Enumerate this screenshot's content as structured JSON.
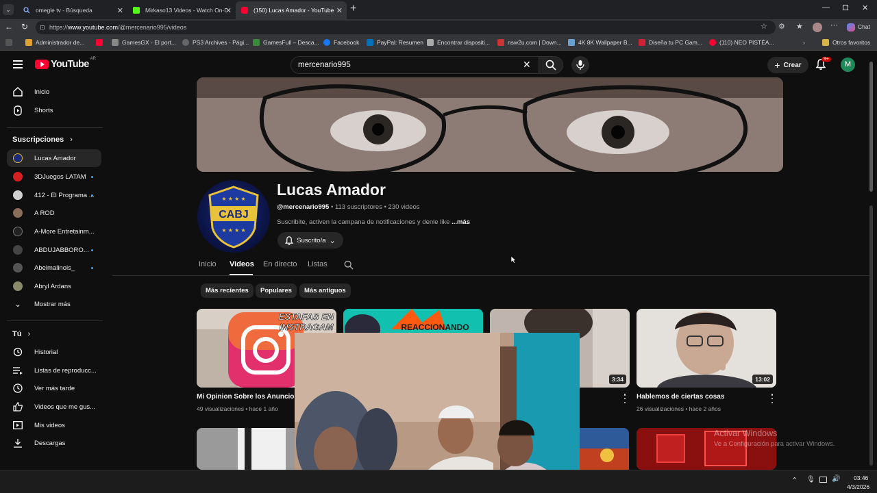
{
  "browser": {
    "tabs": [
      {
        "label": "omegle tv - Búsqueda",
        "active": false
      },
      {
        "label": "Mirkaso13 Videos - Watch On-De",
        "active": false
      },
      {
        "label": "(150) Lucas Amador - YouTube",
        "active": true
      }
    ],
    "new_tab": "+",
    "url_prefix": "https://",
    "url_domain": "www.youtube.com",
    "url_path": "/@mercenario995/videos",
    "chat_label": "Chat",
    "bookmarks": [
      "Administrador de...",
      "GamesGX - El port...",
      "PS3 Archives - Pági...",
      "GamesFull – Desca...",
      "Facebook",
      "PayPal: Resumen",
      "Encontrar dispositi...",
      "nsw2u.com | Down...",
      "4K 8K Wallpaper B...",
      "Diseña tu PC Gam...",
      "(110) NEO PISTÉA..."
    ],
    "other_favorites": "Otros favoritos"
  },
  "youtube": {
    "logo_text": "YouTube",
    "region": "AR",
    "search_value": "mercenario995",
    "create_label": "Crear",
    "notif_badge": "9+",
    "account_initial": "M"
  },
  "sidebar": {
    "top": [
      {
        "label": "Inicio",
        "icon": "home-icon"
      },
      {
        "label": "Shorts",
        "icon": "shorts-icon"
      }
    ],
    "subs_heading": "Suscripciones",
    "subs": [
      {
        "label": "Lucas Amador",
        "color": "#1d2a7a",
        "dot": false
      },
      {
        "label": "3DJuegos LATAM",
        "color": "#d42020",
        "dot": true
      },
      {
        "label": "412 - El Programa ...",
        "color": "#d0d0d0",
        "dot": true
      },
      {
        "label": "A ROD",
        "color": "#8a6d5a",
        "dot": false
      },
      {
        "label": "A-More Entretainm...",
        "color": "#222222",
        "dot": false
      },
      {
        "label": "ABDUJABBORO...",
        "color": "#444444",
        "dot": true
      },
      {
        "label": "Abelmalinois_",
        "color": "#555555",
        "dot": true
      },
      {
        "label": "Abryl Ardans",
        "color": "#8a8a6a",
        "dot": false
      }
    ],
    "show_more": "Mostrar más",
    "you_heading": "Tú",
    "you": [
      {
        "label": "Historial",
        "icon": "history-icon"
      },
      {
        "label": "Listas de reproducc...",
        "icon": "playlist-icon"
      },
      {
        "label": "Ver más tarde",
        "icon": "clock-icon"
      },
      {
        "label": "Videos que me gus...",
        "icon": "like-icon"
      },
      {
        "label": "Mis videos",
        "icon": "my-videos-icon"
      },
      {
        "label": "Descargas",
        "icon": "download-icon"
      }
    ]
  },
  "channel": {
    "name": "Lucas Amador",
    "handle": "@mercenario995",
    "meta": " • 113 suscriptores • 230 videos",
    "description": "Suscribite, activen la campana de notificaciones y denle like ",
    "more": "...más",
    "avatar_text": "CABJ",
    "subscribed_label": "Suscrito/a",
    "tabs": [
      "Inicio",
      "Videos",
      "En directo",
      "Listas"
    ],
    "selected_tab": "Videos",
    "chips": [
      "Más recientes",
      "Populares",
      "Más antiguos"
    ]
  },
  "videos": [
    {
      "title": "Mi Opinion Sobre los Anuncios de",
      "meta": "49 visualizaciones • hace 1 año",
      "thumb_text_1": "ESTAFAS EN",
      "thumb_text_2": "INSTRAGAM",
      "duration": ""
    },
    {
      "title": "",
      "meta": "",
      "thumb_text_1": "REACCIONANDO",
      "thumb_text_2": "",
      "duration": ""
    },
    {
      "title": "",
      "meta": "",
      "thumb_text_1": "",
      "thumb_text_2": "",
      "duration": "3:34"
    },
    {
      "title": "Hablemos de ciertas cosas",
      "meta": "26 visualizaciones • hace 2 años",
      "thumb_text_1": "",
      "thumb_text_2": "",
      "duration": "13:02"
    }
  ],
  "windows": {
    "activate_title": "Activar Windows",
    "activate_sub": "Ve a Configuración para activar Windows.",
    "time": "03:46",
    "date": "4/3/2026"
  }
}
